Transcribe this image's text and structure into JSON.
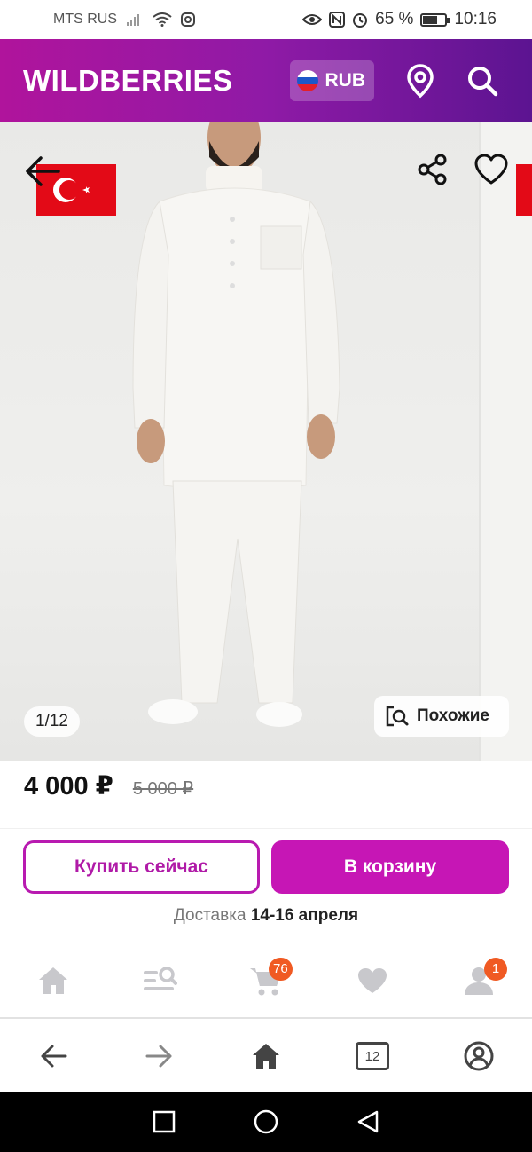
{
  "status_bar": {
    "carrier": "MTS RUS",
    "battery_percent": "65 %",
    "battery_level": 0.65,
    "time": "10:16",
    "icons": [
      "signal-icon",
      "wifi-icon",
      "instagram-icon",
      "eye-icon",
      "nfc-icon",
      "alarm-icon",
      "battery-icon"
    ]
  },
  "header": {
    "logo": "WILDBERRIES",
    "currency": "RUB",
    "icons": [
      "russia-flag-icon",
      "location-pin-icon",
      "search-icon"
    ]
  },
  "gallery": {
    "counter": "1/12",
    "similar_label": "Похожие",
    "icons": [
      "back-arrow-icon",
      "turkey-flag-icon",
      "share-icon",
      "heart-outline-icon",
      "similar-search-icon"
    ]
  },
  "product": {
    "price": "4 000 ₽",
    "old_price": "5 000 ₽"
  },
  "actions": {
    "buy_now": "Купить сейчас",
    "add_to_cart": "В корзину"
  },
  "delivery": {
    "label": "Доставка",
    "dates": "14-16 апреля"
  },
  "app_nav": {
    "items": [
      {
        "icon": "home-icon"
      },
      {
        "icon": "catalog-search-icon"
      },
      {
        "icon": "cart-icon",
        "badge": "76"
      },
      {
        "icon": "heart-icon"
      },
      {
        "icon": "profile-icon",
        "badge": "1"
      }
    ]
  },
  "browser_nav": {
    "tabs_count": "12",
    "icons": [
      "back-icon",
      "forward-icon",
      "home-icon",
      "tabs-icon",
      "account-icon"
    ]
  },
  "system_nav": {
    "icons": [
      "recent-apps-icon",
      "home-circle-icon",
      "back-triangle-icon"
    ]
  },
  "colors": {
    "brand_gradient_start": "#b0149c",
    "brand_gradient_end": "#5c1491",
    "button_primary": "#c616b5",
    "badge": "#f05a23",
    "flag_red": "#e30a17"
  }
}
